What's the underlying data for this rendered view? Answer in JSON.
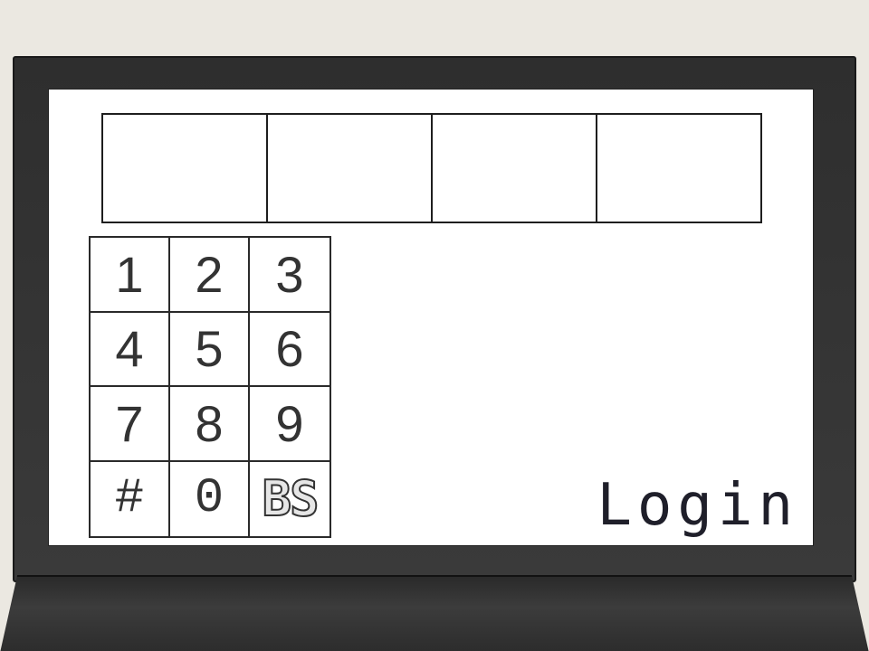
{
  "pin": {
    "digits": [
      "",
      "",
      "",
      ""
    ]
  },
  "keypad": {
    "keys": [
      "1",
      "2",
      "3",
      "4",
      "5",
      "6",
      "7",
      "8",
      "9",
      "#",
      "0",
      "BS"
    ]
  },
  "login": {
    "label": "Login"
  }
}
